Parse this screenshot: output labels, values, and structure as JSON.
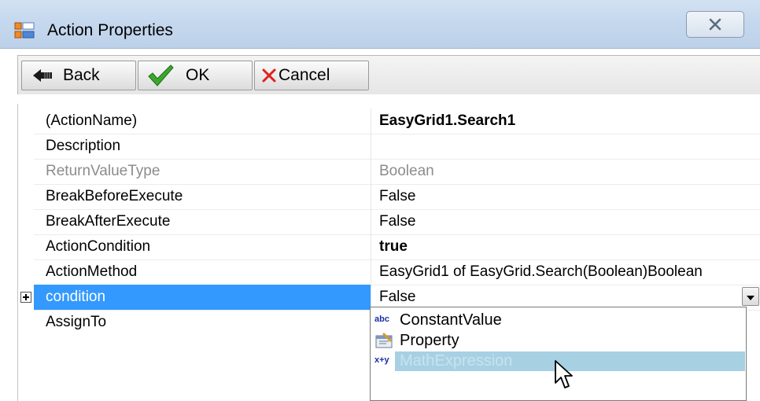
{
  "window": {
    "title": "Action Properties",
    "close_glyph": "×"
  },
  "toolbar": {
    "back_label": "Back",
    "ok_label": "OK",
    "cancel_label": "Cancel"
  },
  "properties": [
    {
      "name": "(ActionName)",
      "value": "EasyGrid1.Search1"
    },
    {
      "name": "Description",
      "value": ""
    },
    {
      "name": "ReturnValueType",
      "value": "Boolean"
    },
    {
      "name": "BreakBeforeExecute",
      "value": "False"
    },
    {
      "name": "BreakAfterExecute",
      "value": "False"
    },
    {
      "name": "ActionCondition",
      "value": "true"
    },
    {
      "name": "ActionMethod",
      "value": "EasyGrid1 of EasyGrid.Search(Boolean)Boolean"
    },
    {
      "name": "condition",
      "value": "False"
    },
    {
      "name": "AssignTo",
      "value": ""
    }
  ],
  "dropdown": {
    "options": [
      {
        "icon": "abc",
        "label": "ConstantValue"
      },
      {
        "icon": "property-icon",
        "label": "Property"
      },
      {
        "icon": "x+y",
        "label": "MathExpression"
      }
    ]
  },
  "colors": {
    "selection": "#3399ff",
    "hover": "#a7d1e3",
    "titlebar": "#c5d8ee"
  }
}
